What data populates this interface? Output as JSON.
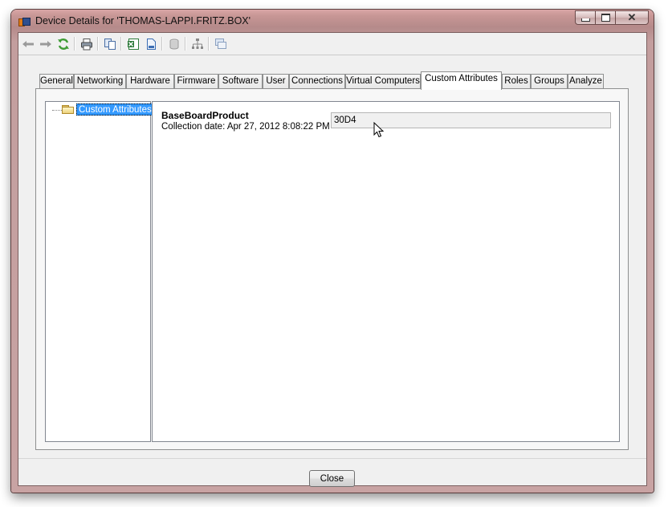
{
  "window": {
    "title": "Device Details for 'THOMAS-LAPPI.FRITZ.BOX'"
  },
  "toolbar": {
    "icons": [
      "back-arrow-icon",
      "forward-arrow-icon",
      "refresh-icon",
      "print-icon",
      "copy-icon",
      "excel-export-icon",
      "document-icon",
      "database-icon",
      "network-tree-icon",
      "windows-icon"
    ]
  },
  "tabs": [
    {
      "label": "General"
    },
    {
      "label": "Networking"
    },
    {
      "label": "Hardware"
    },
    {
      "label": "Firmware"
    },
    {
      "label": "Software"
    },
    {
      "label": "User"
    },
    {
      "label": "Connections"
    },
    {
      "label": "Virtual Computers"
    },
    {
      "label": "Custom Attributes",
      "selected": true
    },
    {
      "label": "Roles"
    },
    {
      "label": "Groups"
    },
    {
      "label": "Analyze"
    }
  ],
  "tree": {
    "selected_item": "Custom Attributes"
  },
  "attribute": {
    "name": "BaseBoardProduct",
    "collection_date": "Collection date: Apr 27, 2012 8:08:22 PM",
    "value": "30D4"
  },
  "footer": {
    "close_label": "Close"
  },
  "colors": {
    "selection": "#3399ff",
    "panel": "#f0f0f0",
    "frame": "#c79695"
  }
}
